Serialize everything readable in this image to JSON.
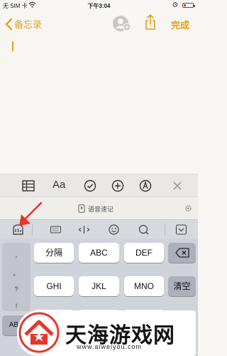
{
  "status_bar": {
    "carrier": "无 SIM 卡",
    "time": "下午3:04"
  },
  "nav": {
    "back_label": "备忘录",
    "done_label": "完成"
  },
  "note": {
    "body_text": ""
  },
  "format_toolbar": {
    "text_style_label": "Aa"
  },
  "voice_bar": {
    "label": "语音速记"
  },
  "keyboard": {
    "punctuation": [
      ",",
      "。",
      "?",
      "!"
    ],
    "keys_row1": [
      "分隔",
      "ABC",
      "DEF"
    ],
    "keys_row2": [
      "GHI",
      "JKL",
      "MNO"
    ],
    "clear_label": "清空",
    "abc_label": "ABC"
  },
  "watermark": {
    "name": "天海游戏网",
    "url": "www.aiweiyou.com"
  },
  "colors": {
    "accent": "#e3a21b",
    "annotation_arrow": "#e5362b",
    "keyboard_bg": "#d0d3d9"
  }
}
